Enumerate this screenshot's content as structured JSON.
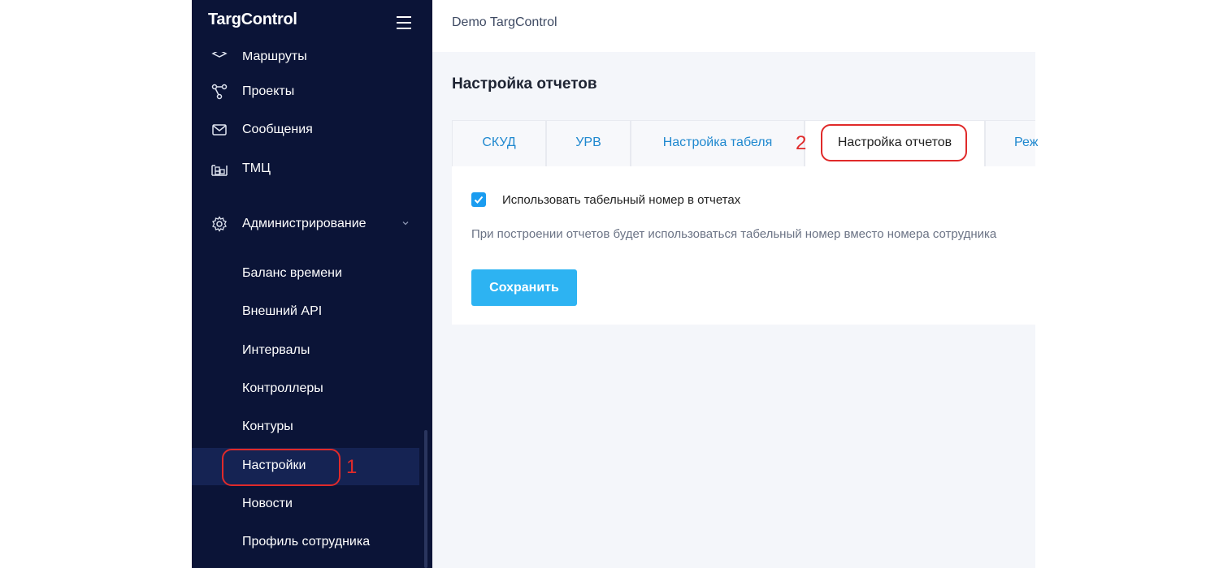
{
  "app": {
    "logo": "TargControl",
    "workspace": "Demo TargControl"
  },
  "sidebar": {
    "items": [
      {
        "label": "Маршруты",
        "icon": "routes-icon"
      },
      {
        "label": "Проекты",
        "icon": "projects-icon"
      },
      {
        "label": "Сообщения",
        "icon": "mail-icon"
      },
      {
        "label": "ТМЦ",
        "icon": "warehouse-icon"
      },
      {
        "label": "Администрирование",
        "icon": "gear-icon",
        "expanded": true
      }
    ],
    "submenu": [
      {
        "label": "Баланс времени"
      },
      {
        "label": "Внешний API"
      },
      {
        "label": "Интервалы"
      },
      {
        "label": "Контроллеры"
      },
      {
        "label": "Контуры"
      },
      {
        "label": "Настройки",
        "active": true
      },
      {
        "label": "Новости"
      },
      {
        "label": "Профиль сотрудника"
      }
    ]
  },
  "page": {
    "title": "Настройка отчетов"
  },
  "tabs": [
    {
      "label": "СКУД"
    },
    {
      "label": "УРВ"
    },
    {
      "label": "Настройка табеля"
    },
    {
      "label": "Настройка отчетов",
      "active": true
    },
    {
      "label": "Реж"
    }
  ],
  "settings": {
    "checkbox_label": "Использовать табельный номер в отчетах",
    "checked": true,
    "hint": "При построении отчетов будет использоваться табельный номер вместо номера сотрудника",
    "save_label": "Сохранить"
  },
  "annotations": [
    {
      "number": "1"
    },
    {
      "number": "2"
    }
  ],
  "colors": {
    "sidebar_bg": "#0b1437",
    "accent": "#2db3f2",
    "tab_text": "#1f88cf",
    "annotation": "#e02a2a"
  }
}
